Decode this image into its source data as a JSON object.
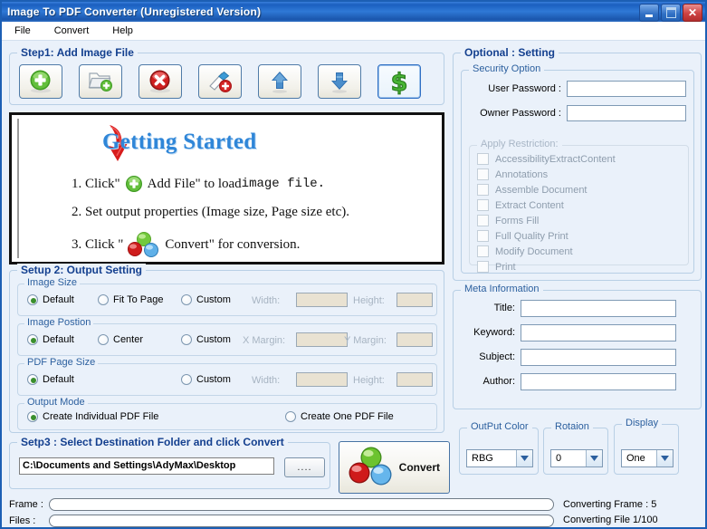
{
  "window": {
    "title": "Image To PDF Converter (Unregistered Version)",
    "minimize": "minimize-button",
    "maximize": "maximize-button",
    "close": "close-button"
  },
  "menu": {
    "items": [
      "File",
      "Convert",
      "Help"
    ]
  },
  "toolbar": {
    "legend": "Step1: Add Image File",
    "buttons": [
      {
        "name": "add-file-button",
        "icon": "add-circle-icon",
        "selected": false
      },
      {
        "name": "add-folder-button",
        "icon": "add-folder-icon",
        "selected": false
      },
      {
        "name": "remove-file-button",
        "icon": "delete-circle-icon",
        "selected": false
      },
      {
        "name": "clear-list-button",
        "icon": "clear-list-icon",
        "selected": false
      },
      {
        "name": "move-up-button",
        "icon": "arrow-up-icon",
        "selected": false
      },
      {
        "name": "move-down-button",
        "icon": "arrow-down-icon",
        "selected": false
      },
      {
        "name": "register-button",
        "icon": "dollar-icon",
        "selected": true
      }
    ]
  },
  "getting_started": {
    "heading": "Getting Started",
    "step1_a": "1. Click\"",
    "step1_b": "Add File\"  to load ",
    "step1_mono": "image file.",
    "step2": "2. Set output properties (Image size, Page size etc).",
    "step3_a": "3. Click \"",
    "step3_b": "Convert\"  for conversion."
  },
  "setup2": {
    "legend": "Setup 2:  Output Setting",
    "image_size": {
      "legend": "Image Size",
      "options": [
        {
          "label": "Default",
          "selected": true
        },
        {
          "label": "Fit To Page",
          "selected": false
        },
        {
          "label": "Custom",
          "selected": false
        }
      ],
      "width_label": "Width:",
      "width_value": "",
      "height_label": "Height:",
      "height_value": "",
      "enabled": false
    },
    "image_position": {
      "legend": "Image Postion",
      "options": [
        {
          "label": "Default",
          "selected": true
        },
        {
          "label": "Center",
          "selected": false
        },
        {
          "label": "Custom",
          "selected": false
        }
      ],
      "xmargin_label": "X Margin:",
      "xmargin_value": "",
      "ymargin_label": "Y Margin:",
      "ymargin_value": "",
      "enabled": false
    },
    "pdf_page_size": {
      "legend": "PDF Page Size",
      "options": [
        {
          "label": "Default",
          "selected": true
        },
        {
          "label": "Custom",
          "selected": false
        }
      ],
      "width_label": "Width:",
      "width_value": "",
      "height_label": "Height:",
      "height_value": "",
      "enabled": false
    },
    "output_mode": {
      "legend": "Output Mode",
      "options": [
        {
          "label": "Create Individual PDF File",
          "selected": true
        },
        {
          "label": "Create One PDF File",
          "selected": false
        }
      ]
    }
  },
  "setp3": {
    "legend": "Setp3 : Select Destination Folder and click Convert",
    "path": "C:\\Documents and Settings\\AdyMax\\Desktop",
    "browse_label": "....",
    "convert_label": "Convert"
  },
  "progress": {
    "frame_label": "Frame :",
    "files_label": "Files :",
    "frame_percent": 0,
    "files_percent": 0
  },
  "optional": {
    "legend": "Optional :  Setting",
    "security": {
      "legend": "Security Option",
      "user_password_label": "User Password :",
      "user_password_value": "",
      "owner_password_label": "Owner Password :",
      "owner_password_value": "",
      "restrictions": {
        "legend": "Apply Restriction:",
        "enabled": false,
        "items": [
          {
            "label": "AccessibilityExtractContent",
            "checked": false
          },
          {
            "label": "Annotations",
            "checked": false
          },
          {
            "label": "Assemble Document",
            "checked": false
          },
          {
            "label": "Extract Content",
            "checked": false
          },
          {
            "label": "Forms Fill",
            "checked": false
          },
          {
            "label": "Full Quality Print",
            "checked": false
          },
          {
            "label": "Modify Document",
            "checked": false
          },
          {
            "label": "Print",
            "checked": false
          }
        ]
      }
    }
  },
  "meta": {
    "legend": "Meta Information",
    "fields": [
      {
        "label": "Title:",
        "value": ""
      },
      {
        "label": "Keyword:",
        "value": ""
      },
      {
        "label": "Subject:",
        "value": ""
      },
      {
        "label": "Author:",
        "value": ""
      }
    ]
  },
  "dropdowns": {
    "output_color": {
      "legend": "OutPut Color",
      "value": "RBG"
    },
    "rotation": {
      "legend": "Rotaion",
      "value": "0"
    },
    "display": {
      "legend": "Display",
      "value": "One"
    }
  },
  "status": {
    "converting_frame": "Converting Frame : 5",
    "converting_file": "Converting File     1/100"
  },
  "colors": {
    "titlebar": "#1b5fc0",
    "window_bg": "#eaf1fa",
    "legend_blue": "#2b5f9e",
    "heading_blue": "#14408f",
    "accent_green": "#3a8f2d",
    "close_red": "#cd4242"
  }
}
